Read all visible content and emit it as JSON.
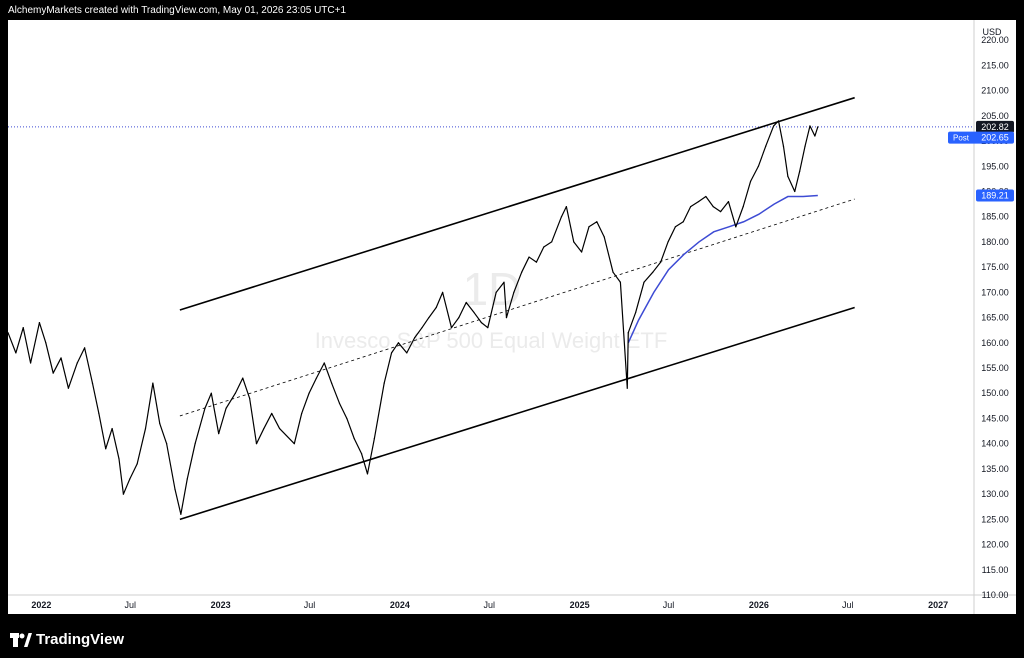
{
  "header": {
    "attribution": "AlchemyMarkets created with TradingView.com, May 01, 2026 23:05 UTC+1"
  },
  "footer": {
    "brand": "TradingView",
    "brand_icon": "tradingview-logo-icon"
  },
  "chart_data": {
    "type": "line",
    "title": "Invesco S&P 500 Equal Weight ETF",
    "watermark_interval": "1D",
    "currency": "USD",
    "ylim": [
      110,
      224
    ],
    "y_ticks": [
      220,
      215,
      210,
      205,
      200,
      195,
      190,
      185,
      180,
      175,
      170,
      165,
      160,
      155,
      150,
      145,
      140,
      135,
      130,
      125,
      120,
      115,
      110
    ],
    "y_tick_labels": [
      "220.00",
      "215.00",
      "210.00",
      "205.00",
      "200.00",
      "195.00",
      "190.00",
      "185.00",
      "180.00",
      "175.00",
      "170.00",
      "165.00",
      "160.00",
      "155.00",
      "150.00",
      "145.00",
      "140.00",
      "135.00",
      "130.00",
      "125.00",
      "120.00",
      "115.00",
      "110.00"
    ],
    "x_range": [
      "2021-10-25",
      "2027-03-15"
    ],
    "x_ticks": [
      {
        "date": "2022-01-01",
        "label": "2022",
        "bold": true
      },
      {
        "date": "2022-07-01",
        "label": "Jul",
        "bold": false
      },
      {
        "date": "2023-01-01",
        "label": "2023",
        "bold": true
      },
      {
        "date": "2023-07-01",
        "label": "Jul",
        "bold": false
      },
      {
        "date": "2024-01-01",
        "label": "2024",
        "bold": true
      },
      {
        "date": "2024-07-01",
        "label": "Jul",
        "bold": false
      },
      {
        "date": "2025-01-01",
        "label": "2025",
        "bold": true
      },
      {
        "date": "2025-07-01",
        "label": "Jul",
        "bold": false
      },
      {
        "date": "2026-01-01",
        "label": "2026",
        "bold": true
      },
      {
        "date": "2026-07-01",
        "label": "Jul",
        "bold": false
      },
      {
        "date": "2027-01-01",
        "label": "2027",
        "bold": true
      }
    ],
    "price_series": [
      [
        "2021-10-25",
        162
      ],
      [
        "2021-11-10",
        158
      ],
      [
        "2021-11-25",
        163
      ],
      [
        "2021-12-10",
        156
      ],
      [
        "2021-12-28",
        164
      ],
      [
        "2022-01-10",
        160
      ],
      [
        "2022-01-25",
        154
      ],
      [
        "2022-02-10",
        157
      ],
      [
        "2022-02-25",
        151
      ],
      [
        "2022-03-15",
        156
      ],
      [
        "2022-03-30",
        159
      ],
      [
        "2022-04-15",
        152
      ],
      [
        "2022-04-28",
        146
      ],
      [
        "2022-05-12",
        139
      ],
      [
        "2022-05-25",
        143
      ],
      [
        "2022-06-08",
        137
      ],
      [
        "2022-06-17",
        130
      ],
      [
        "2022-06-30",
        133
      ],
      [
        "2022-07-15",
        136
      ],
      [
        "2022-08-01",
        143
      ],
      [
        "2022-08-16",
        152
      ],
      [
        "2022-08-30",
        144
      ],
      [
        "2022-09-13",
        140
      ],
      [
        "2022-09-30",
        131
      ],
      [
        "2022-10-12",
        126
      ],
      [
        "2022-10-25",
        133
      ],
      [
        "2022-11-10",
        140
      ],
      [
        "2022-11-30",
        147
      ],
      [
        "2022-12-13",
        150
      ],
      [
        "2022-12-28",
        142
      ],
      [
        "2023-01-12",
        147
      ],
      [
        "2023-01-31",
        150
      ],
      [
        "2023-02-15",
        153
      ],
      [
        "2023-03-01",
        149
      ],
      [
        "2023-03-15",
        140
      ],
      [
        "2023-03-30",
        143
      ],
      [
        "2023-04-15",
        146
      ],
      [
        "2023-05-01",
        143
      ],
      [
        "2023-05-31",
        140
      ],
      [
        "2023-06-15",
        146
      ],
      [
        "2023-06-30",
        150
      ],
      [
        "2023-07-15",
        153
      ],
      [
        "2023-07-31",
        156
      ],
      [
        "2023-08-15",
        152
      ],
      [
        "2023-08-31",
        148
      ],
      [
        "2023-09-15",
        145
      ],
      [
        "2023-09-30",
        141
      ],
      [
        "2023-10-15",
        138
      ],
      [
        "2023-10-27",
        134
      ],
      [
        "2023-11-10",
        141
      ],
      [
        "2023-11-30",
        152
      ],
      [
        "2023-12-15",
        158
      ],
      [
        "2023-12-29",
        160
      ],
      [
        "2024-01-15",
        158
      ],
      [
        "2024-01-31",
        161
      ],
      [
        "2024-02-15",
        163
      ],
      [
        "2024-02-29",
        165
      ],
      [
        "2024-03-15",
        167
      ],
      [
        "2024-03-28",
        170
      ],
      [
        "2024-04-15",
        163
      ],
      [
        "2024-04-30",
        165
      ],
      [
        "2024-05-15",
        168
      ],
      [
        "2024-05-31",
        166
      ],
      [
        "2024-06-15",
        164
      ],
      [
        "2024-06-28",
        163
      ],
      [
        "2024-07-15",
        170
      ],
      [
        "2024-07-31",
        172
      ],
      [
        "2024-08-05",
        165
      ],
      [
        "2024-08-20",
        170
      ],
      [
        "2024-09-05",
        174
      ],
      [
        "2024-09-20",
        177
      ],
      [
        "2024-10-05",
        176
      ],
      [
        "2024-10-20",
        179
      ],
      [
        "2024-11-05",
        180
      ],
      [
        "2024-11-25",
        185
      ],
      [
        "2024-12-05",
        187
      ],
      [
        "2024-12-20",
        180
      ],
      [
        "2025-01-05",
        178
      ],
      [
        "2025-01-20",
        183
      ],
      [
        "2025-02-05",
        184
      ],
      [
        "2025-02-20",
        181
      ],
      [
        "2025-03-10",
        174
      ],
      [
        "2025-03-25",
        172
      ],
      [
        "2025-04-08",
        151
      ],
      [
        "2025-04-10",
        162
      ],
      [
        "2025-04-25",
        166
      ],
      [
        "2025-05-12",
        172
      ],
      [
        "2025-05-30",
        174
      ],
      [
        "2025-06-15",
        176
      ],
      [
        "2025-06-30",
        180
      ],
      [
        "2025-07-15",
        183
      ],
      [
        "2025-07-31",
        184
      ],
      [
        "2025-08-15",
        187
      ],
      [
        "2025-08-31",
        188
      ],
      [
        "2025-09-15",
        189
      ],
      [
        "2025-09-30",
        187
      ],
      [
        "2025-10-15",
        186
      ],
      [
        "2025-10-31",
        188
      ],
      [
        "2025-11-15",
        183
      ],
      [
        "2025-11-30",
        187
      ],
      [
        "2025-12-15",
        192
      ],
      [
        "2025-12-31",
        195
      ],
      [
        "2026-01-15",
        199
      ],
      [
        "2026-01-31",
        203
      ],
      [
        "2026-02-10",
        204
      ],
      [
        "2026-02-20",
        199
      ],
      [
        "2026-03-01",
        193
      ],
      [
        "2026-03-15",
        190
      ],
      [
        "2026-03-25",
        194
      ],
      [
        "2026-04-05",
        199
      ],
      [
        "2026-04-15",
        203
      ],
      [
        "2026-04-25",
        201
      ],
      [
        "2026-05-01",
        202.82
      ]
    ],
    "ma_series": [
      [
        "2025-04-10",
        160
      ],
      [
        "2025-05-01",
        164.5
      ],
      [
        "2025-06-01",
        170
      ],
      [
        "2025-07-01",
        174.5
      ],
      [
        "2025-08-01",
        177.5
      ],
      [
        "2025-09-01",
        180
      ],
      [
        "2025-10-01",
        182
      ],
      [
        "2025-11-01",
        183
      ],
      [
        "2025-12-01",
        184
      ],
      [
        "2026-01-01",
        185.5
      ],
      [
        "2026-02-01",
        187.5
      ],
      [
        "2026-03-01",
        189
      ],
      [
        "2026-04-01",
        189
      ],
      [
        "2026-05-01",
        189.21
      ]
    ],
    "channel_lines": [
      {
        "kind": "solid",
        "from": [
          "2022-10-10",
          166.5
        ],
        "to": [
          "2026-07-15",
          208.6
        ]
      },
      {
        "kind": "solid",
        "from": [
          "2022-10-10",
          125
        ],
        "to": [
          "2026-07-15",
          167
        ]
      },
      {
        "kind": "dashed",
        "from": [
          "2022-10-10",
          145.5
        ],
        "to": [
          "2026-07-15",
          188.5
        ]
      }
    ],
    "last_price": {
      "value": 202.82,
      "label": "202.82"
    },
    "post_price": {
      "tag": "Post",
      "value": 202.65,
      "label": "202.65"
    },
    "ma_price": {
      "value": 189.21,
      "label": "189.21"
    },
    "colors": {
      "background": "#ffffff",
      "price": "#000000",
      "ma": "#3d4bd4",
      "post_badge": "#2962ff",
      "last_badge": "#131722",
      "price_dotted": "#3d4bd4",
      "channel": "#000000"
    }
  }
}
